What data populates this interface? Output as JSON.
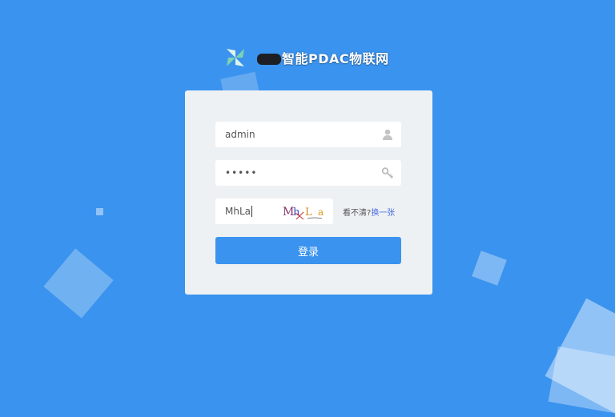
{
  "brand": {
    "title": "智能PDAC物联网",
    "logo_icon": "windmill-logo-icon",
    "accent": "#3a93ee"
  },
  "login": {
    "username": "admin",
    "password": "•••••",
    "captcha_input": "MhLa",
    "captcha_image_text": [
      "M",
      "h",
      "L",
      "a"
    ],
    "captcha_hint": "看不清?",
    "captcha_refresh": "换一张",
    "submit": "登录",
    "user_icon": "user-icon",
    "key_icon": "key-icon"
  }
}
